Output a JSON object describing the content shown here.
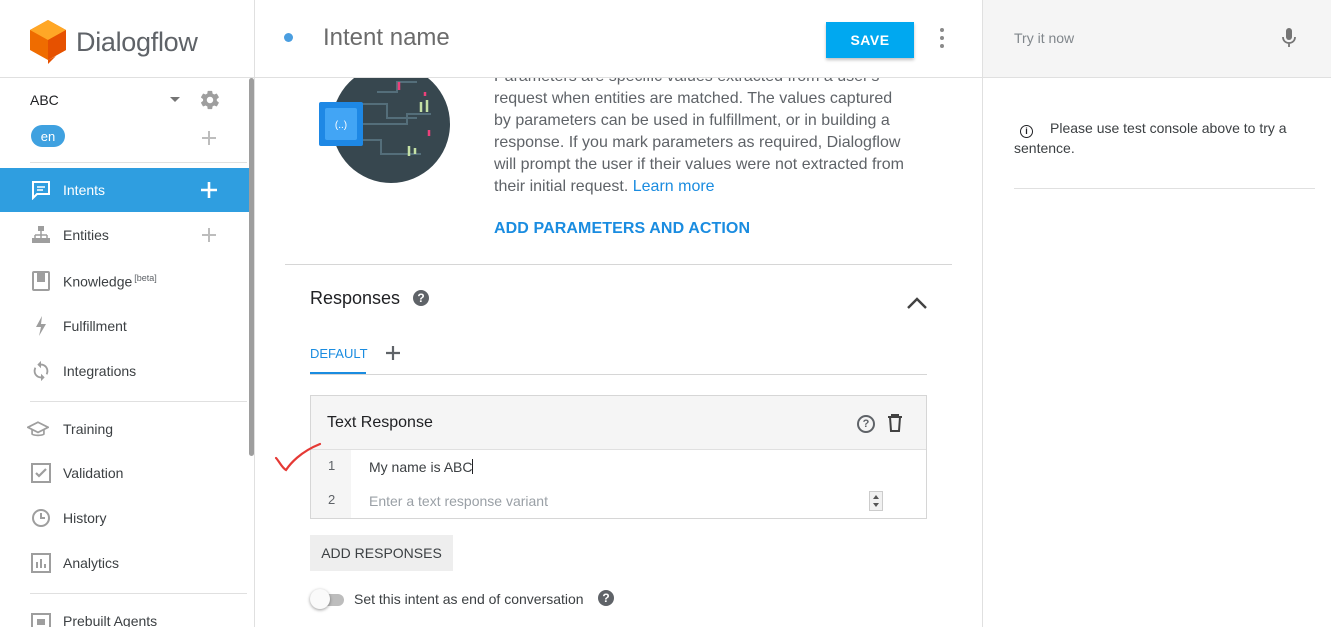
{
  "app": {
    "logo_text": "Dialogflow",
    "accent_color": "#2f9ee0",
    "save_color": "#00a8f0"
  },
  "sidebar": {
    "agent_name": "ABC",
    "language": "en",
    "items": [
      {
        "label": "Intents",
        "icon": "chat-icon",
        "active": true
      },
      {
        "label": "Entities",
        "icon": "entities-icon"
      },
      {
        "label": "Knowledge",
        "beta": "[beta]",
        "icon": "book-icon"
      },
      {
        "label": "Fulfillment",
        "icon": "bolt-icon"
      },
      {
        "label": "Integrations",
        "icon": "sync-icon"
      },
      {
        "label": "Training",
        "icon": "graduation-cap-icon"
      },
      {
        "label": "Validation",
        "icon": "check-box-icon"
      },
      {
        "label": "History",
        "icon": "clock-icon"
      },
      {
        "label": "Analytics",
        "icon": "bar-chart-icon"
      },
      {
        "label": "Prebuilt Agents",
        "icon": "agent-icon"
      }
    ]
  },
  "header": {
    "intent_name_placeholder": "Intent name",
    "save_label": "SAVE"
  },
  "parameters": {
    "description": "Parameters are specific values extracted from a user's request when entities are matched. The values captured by parameters can be used in fulfillment, or in building a response. If you mark parameters as required, Dialogflow will prompt the user if their values were not extracted from their initial request.",
    "learn_more": "Learn more",
    "add_label": "ADD PARAMETERS AND ACTION"
  },
  "responses": {
    "title": "Responses",
    "tabs": [
      {
        "label": "DEFAULT"
      }
    ],
    "text_response": {
      "title": "Text Response",
      "rows": [
        {
          "num": "1",
          "value": "My name is ABC"
        },
        {
          "num": "2",
          "placeholder": "Enter a text response variant"
        }
      ]
    },
    "add_responses_label": "ADD RESPONSES",
    "end_conversation_label": "Set this intent as end of conversation",
    "end_conversation_on": false
  },
  "right_panel": {
    "try_placeholder": "Try it now",
    "info_text": "Please use test console above to try a sentence."
  }
}
